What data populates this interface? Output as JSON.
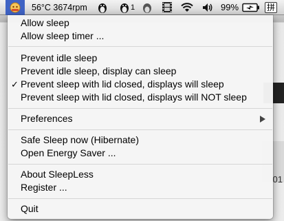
{
  "menubar": {
    "temp_rpm": "56°C 3674rpm",
    "qq_badge": "1",
    "battery_percent": "99%",
    "input_method_label": "拼"
  },
  "menu": {
    "allow_sleep": "Allow sleep",
    "allow_sleep_timer": "Allow sleep timer ...",
    "prevent_idle_sleep": "Prevent idle sleep",
    "prevent_idle_display": "Prevent idle sleep, display can sleep",
    "prevent_lid_displays_sleep": "Prevent sleep with lid closed, displays will sleep",
    "prevent_lid_displays_not_sleep": "Prevent sleep with lid closed, displays will NOT sleep",
    "preferences": "Preferences",
    "safe_sleep_now": "Safe Sleep now (Hibernate)",
    "open_energy_saver": "Open Energy Saver ...",
    "about": "About SleepLess",
    "register": "Register ...",
    "quit": "Quit",
    "checked_item": "prevent_lid_displays_sleep"
  },
  "background": {
    "text_fragment": "01"
  },
  "colors": {
    "menubar_highlight": "#3f63c4",
    "menu_bg": "#f5f5f5"
  }
}
